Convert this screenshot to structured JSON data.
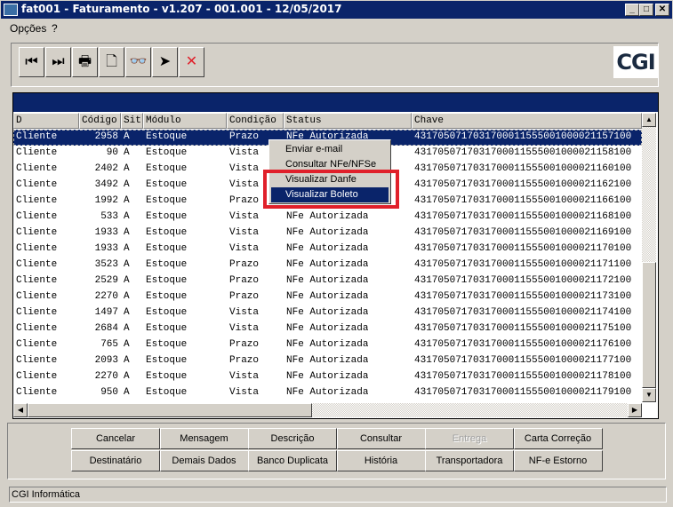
{
  "window": {
    "title": "fat001 - Faturamento - v1.207 - 001.001 - 12/05/2017",
    "minimize": "_",
    "maximize": "□",
    "close": "✕"
  },
  "menu": [
    "Opções",
    "?"
  ],
  "toolbar": [
    {
      "icon": "first-record-icon",
      "glyph": "⏮"
    },
    {
      "icon": "last-record-icon",
      "glyph": "⏭"
    },
    {
      "icon": "printer-icon",
      "glyph": "🖶"
    },
    {
      "icon": "new-document-icon",
      "glyph": "🗋"
    },
    {
      "icon": "binoculars-search-icon",
      "glyph": "👓"
    },
    {
      "icon": "send-icon",
      "glyph": "➤"
    },
    {
      "icon": "delete-icon",
      "glyph": "✕"
    }
  ],
  "logo": "CGI",
  "columns": [
    "D",
    "Código",
    "Sit",
    "Módulo",
    "Condição",
    "Status",
    "Chave"
  ],
  "rows": [
    [
      "Cliente",
      "2958",
      "A",
      "Estoque",
      "Prazo",
      "NFe Autorizada",
      "4317050717031700011555001000021157100"
    ],
    [
      "Cliente",
      "90",
      "A",
      "Estoque",
      "Vista",
      "NFe Autorizada",
      "4317050717031700011555001000021158100"
    ],
    [
      "Cliente",
      "2402",
      "A",
      "Estoque",
      "Vista",
      "NFe Autorizada",
      "4317050717031700011555001000021160100"
    ],
    [
      "Cliente",
      "3492",
      "A",
      "Estoque",
      "Vista",
      "NFe Autorizada",
      "4317050717031700011555001000021162100"
    ],
    [
      "Cliente",
      "1992",
      "A",
      "Estoque",
      "Prazo",
      "NFe Autorizada",
      "4317050717031700011555001000021166100"
    ],
    [
      "Cliente",
      "533",
      "A",
      "Estoque",
      "Vista",
      "NFe Autorizada",
      "4317050717031700011555001000021168100"
    ],
    [
      "Cliente",
      "1933",
      "A",
      "Estoque",
      "Vista",
      "NFe Autorizada",
      "4317050717031700011555001000021169100"
    ],
    [
      "Cliente",
      "1933",
      "A",
      "Estoque",
      "Vista",
      "NFe Autorizada",
      "4317050717031700011555001000021170100"
    ],
    [
      "Cliente",
      "3523",
      "A",
      "Estoque",
      "Prazo",
      "NFe Autorizada",
      "4317050717031700011555001000021171100"
    ],
    [
      "Cliente",
      "2529",
      "A",
      "Estoque",
      "Prazo",
      "NFe Autorizada",
      "4317050717031700011555001000021172100"
    ],
    [
      "Cliente",
      "2270",
      "A",
      "Estoque",
      "Prazo",
      "NFe Autorizada",
      "4317050717031700011555001000021173100"
    ],
    [
      "Cliente",
      "1497",
      "A",
      "Estoque",
      "Vista",
      "NFe Autorizada",
      "4317050717031700011555001000021174100"
    ],
    [
      "Cliente",
      "2684",
      "A",
      "Estoque",
      "Vista",
      "NFe Autorizada",
      "4317050717031700011555001000021175100"
    ],
    [
      "Cliente",
      "765",
      "A",
      "Estoque",
      "Prazo",
      "NFe Autorizada",
      "4317050717031700011555001000021176100"
    ],
    [
      "Cliente",
      "2093",
      "A",
      "Estoque",
      "Prazo",
      "NFe Autorizada",
      "4317050717031700011555001000021177100"
    ],
    [
      "Cliente",
      "2270",
      "A",
      "Estoque",
      "Vista",
      "NFe Autorizada",
      "4317050717031700011555001000021178100"
    ],
    [
      "Cliente",
      "950",
      "A",
      "Estoque",
      "Vista",
      "NFe Autorizada",
      "4317050717031700011555001000021179100"
    ]
  ],
  "context_menu": [
    "Enviar e-mail",
    "Consultar NFe/NFSe",
    "Visualizar Danfe",
    "Visualizar Boleto"
  ],
  "buttons_row1": [
    {
      "label": "Cancelar"
    },
    {
      "label": "Mensagem"
    },
    {
      "label": "Descrição"
    },
    {
      "label": "Consultar"
    },
    {
      "label": "Entrega",
      "disabled": true
    },
    {
      "label": "Carta Correção"
    }
  ],
  "buttons_row2": [
    {
      "label": "Destinatário"
    },
    {
      "label": "Demais Dados"
    },
    {
      "label": "Banco Duplicata"
    },
    {
      "label": "História"
    },
    {
      "label": "Transportadora"
    },
    {
      "label": "NF-e Estorno"
    }
  ],
  "statusbar": "CGI Informática",
  "colors": {
    "selection": "#0a246a",
    "highlight_box": "#e0202a"
  }
}
